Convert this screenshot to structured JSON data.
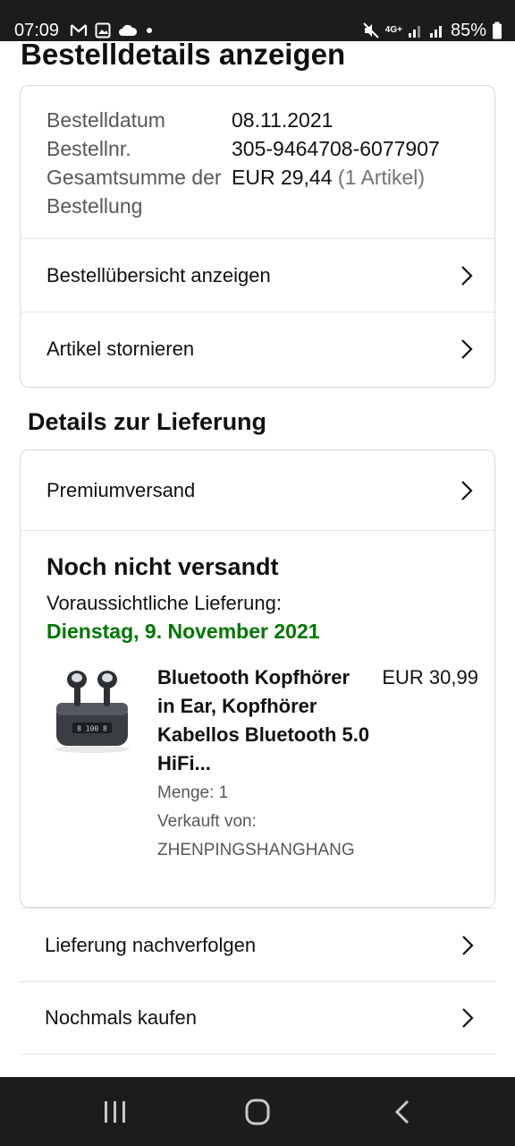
{
  "status_bar": {
    "time": "07:09",
    "left_icons": [
      "gmail-icon",
      "image-icon",
      "cloud-icon",
      "dot-icon"
    ],
    "network": "4G+",
    "battery": "85%"
  },
  "page": {
    "title": "Bestelldetails anzeigen"
  },
  "summary": {
    "rows": [
      {
        "label": "Bestelldatum",
        "value": "08.11.2021"
      },
      {
        "label": "Bestellnr.",
        "value": "305-9464708-6077907"
      },
      {
        "label": "Gesamtsumme der Bestellung",
        "value": "EUR 29,44",
        "extra": "(1 Artikel)"
      }
    ],
    "links": [
      {
        "label": "Bestellübersicht anzeigen"
      },
      {
        "label": "Artikel stornieren"
      }
    ]
  },
  "delivery": {
    "section_title": "Details zur Lieferung",
    "shipping_label": "Premiumversand",
    "status": "Noch nicht versandt",
    "eta_label": "Voraussichtliche Lieferung:",
    "eta_date": "Dienstag, 9. November 2021",
    "product": {
      "title": "Bluetooth Kopfhörer in Ear, Kopfhörer Kabellos Bluetooth 5.0 HiFi...",
      "price": "EUR 30,99",
      "quantity": "Menge: 1",
      "sold_by_label": "Verkauft von:",
      "seller": "ZHENPINGSHANGHANG",
      "image_icon": "earbuds-product-image"
    }
  },
  "actions": [
    {
      "label": "Lieferung nachverfolgen"
    },
    {
      "label": "Nochmals kaufen"
    }
  ],
  "colors": {
    "status_bar_bg": "#1c1c1c",
    "eta_green": "#007600",
    "border": "#d5d9d9",
    "muted_text": "#565959"
  },
  "nav_bar": {
    "buttons": [
      "recent-apps-icon",
      "home-icon",
      "back-icon"
    ]
  }
}
